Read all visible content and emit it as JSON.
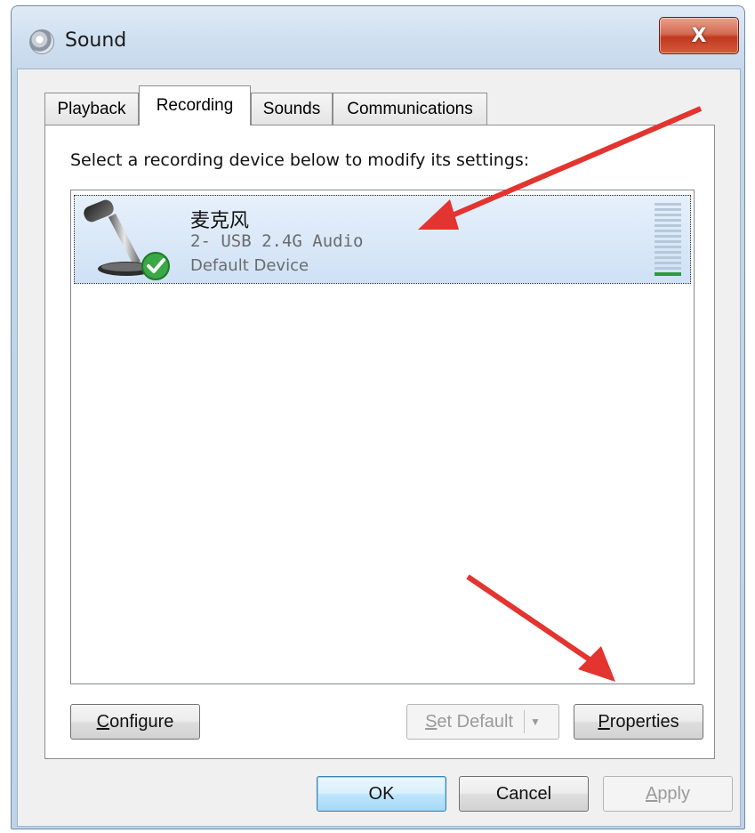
{
  "window": {
    "title": "Sound",
    "close_symbol": "X"
  },
  "tabs": [
    {
      "label": "Playback"
    },
    {
      "label": "Recording"
    },
    {
      "label": "Sounds"
    },
    {
      "label": "Communications"
    }
  ],
  "recording": {
    "instruction": "Select a recording device below to modify its settings:",
    "devices": [
      {
        "name": "麦克风",
        "description": "2- USB 2.4G Audio",
        "status": "Default Device",
        "icon": "microphone-icon",
        "status_icon": "green-check-icon",
        "level_segments": 14,
        "level_active_segments": 1,
        "level_color": "#2f9a3a"
      }
    ],
    "buttons": {
      "configure_mnemonic": "C",
      "configure_rest": "onfigure",
      "set_default_mnemonic": "S",
      "set_default_rest": "et Default",
      "properties_mnemonic": "P",
      "properties_rest": "roperties"
    }
  },
  "dialog_buttons": {
    "ok": "OK",
    "cancel": "Cancel",
    "apply_mnemonic": "A",
    "apply_rest": "pply"
  },
  "annotation_color": "#e3342f"
}
